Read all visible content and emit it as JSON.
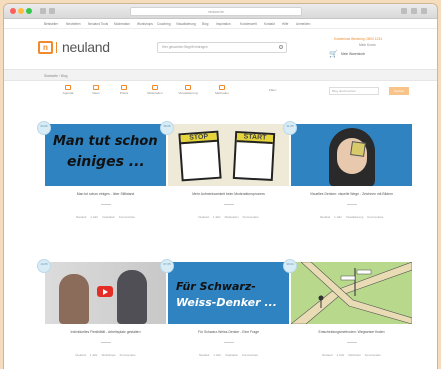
{
  "browser": {
    "url": "neuland.de"
  },
  "topnav": [
    "Bestseller",
    "Neuheiten",
    "Neuland Tools",
    "Moderation",
    "Workshops",
    "Coaching",
    "Visualisierung",
    "Blog",
    "Inspiration",
    "Kundenwelt",
    "Kontakt",
    "Hilfe",
    "Anmelden"
  ],
  "header": {
    "logo_mark": "n",
    "logo_text": "neuland",
    "search_placeholder": "Hier gesuchten Begriff eintragen",
    "hotline": "Kostenlose Beratung: 0800 1234",
    "account": "Mein Konto",
    "cart_label": "Mein Warenkorb"
  },
  "breadcrumb": "Startseite › Blog",
  "categories": [
    "Agenda",
    "Ideen",
    "Praxis",
    "Materialien",
    "Visualisierung",
    "Methoden"
  ],
  "filter": {
    "label": "Filter:",
    "search_placeholder": "Blog durchsuchen",
    "button": "Suchen"
  },
  "posts": [
    {
      "date": "04.06",
      "image_text": [
        "Man tut schon",
        "einiges ..."
      ],
      "title": "Man tut schon einiges - über Stillstand",
      "meta": [
        "Neuland",
        "1 Jahr",
        "Inspiration",
        "Kommentare"
      ]
    },
    {
      "date": "28.05",
      "image_text": [
        "STOP",
        "START"
      ],
      "title": "Mehr Aufmerksamkeit beim Moderationsprozess",
      "meta": [
        "Neuland",
        "1 Jahr",
        "Moderation",
        "Kommentare"
      ]
    },
    {
      "date": "21.05",
      "image_text": [],
      "title": "Visuelles Denken: visuelle Wege - Zeichnen mit Bildern",
      "meta": [
        "Neuland",
        "1 Jahr",
        "Visualisierung",
        "Kommentare"
      ]
    },
    {
      "date": "14.05",
      "image_text": [],
      "title": "Individuelles Flexibilität - Arbeitsplatz gestalten",
      "meta": [
        "Neuland",
        "1 Jahr",
        "Workshops",
        "Kommentare"
      ]
    },
    {
      "date": "07.05",
      "image_text": [
        "Für Schwarz-",
        "Weiss-Denker ..."
      ],
      "title": "Für Schwarz-Weiss-Denker - Eine Frage",
      "meta": [
        "Neuland",
        "1 Jahr",
        "Inspiration",
        "Kommentare"
      ]
    },
    {
      "date": "30.04",
      "image_text": [],
      "title": "Entscheidungsmethoden: Wegweiser finden",
      "meta": [
        "Neuland",
        "1 Jahr",
        "Methoden",
        "Kommentare"
      ]
    }
  ],
  "colors": {
    "accent": "#f08a2c",
    "background": "#f4dcbc",
    "caption_bar": "#2f83c0"
  }
}
